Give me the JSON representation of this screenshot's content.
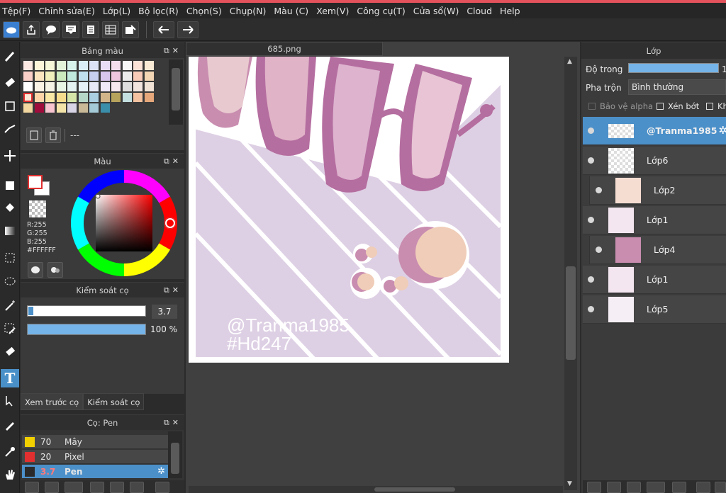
{
  "menu": [
    "Tệp(F)",
    "Chỉnh sửa(E)",
    "Lớp(L)",
    "Bộ lọc(R)",
    "Chọn(S)",
    "Chụp(N)",
    "Màu (C)",
    "Xem(V)",
    "Công cụ(T)",
    "Cửa sổ(W)",
    "Cloud",
    "Help"
  ],
  "palette_panel": {
    "title": "Bảng màu",
    "name_value": "---"
  },
  "color_panel": {
    "title": "Màu",
    "r": "R:255",
    "g": "G:255",
    "b": "B:255",
    "hex": "#FFFFFF"
  },
  "brush_control": {
    "title": "Kiểm soát cọ",
    "size": "3.7",
    "opacity": "100 %",
    "opacity_fraction": 1.0
  },
  "tabs": [
    "Xem trước cọ",
    "Kiểm soát cọ"
  ],
  "brush_panel": {
    "title": "Cọ: Pen",
    "items": [
      {
        "size": "70",
        "name": "Mây",
        "color": "#f2d000"
      },
      {
        "size": "20",
        "name": "Pixel",
        "color": "#e23030"
      },
      {
        "size": "3.7",
        "name": "Pen",
        "color": "#2a2a2a"
      }
    ]
  },
  "document": {
    "tab": "685.png",
    "watermark_line1": "@Tranma1985",
    "watermark_line2": "#Hd247"
  },
  "layers_panel": {
    "title": "Lớp",
    "opacity_label": "Độ trong",
    "opacity_value": "1",
    "blend_label": "Pha trộn",
    "blend_value": "Bình thường",
    "protect_alpha": "Bảo vệ alpha",
    "clip": "Xén bớt",
    "lock": "Kh",
    "layers": [
      {
        "name": "@Tranma1985",
        "selected": true
      },
      {
        "name": "Lớp6"
      },
      {
        "name": "Lớp2",
        "indent": true
      },
      {
        "name": "Lớp1"
      },
      {
        "name": "Lớp4",
        "indent": true
      },
      {
        "name": "Lớp1"
      },
      {
        "name": "Lớp5"
      }
    ]
  },
  "colors": {
    "accent": "#4c90c9",
    "menubar_top": "#e4535c",
    "canvas_bg": "#ded0e4"
  }
}
